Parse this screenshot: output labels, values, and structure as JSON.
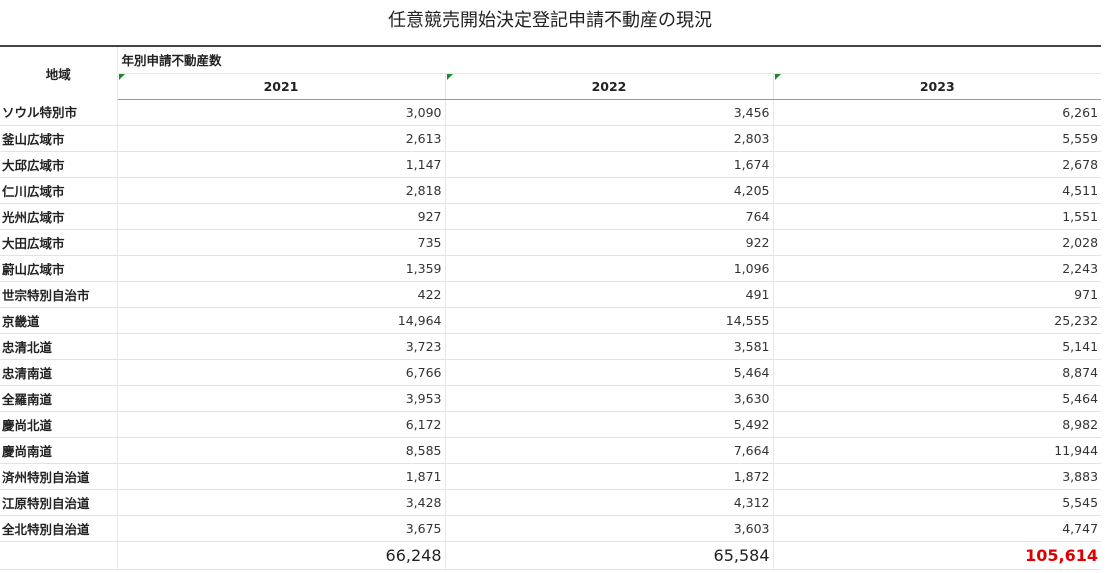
{
  "title": "任意競売開始決定登記申請不動産の現況",
  "header": {
    "region_label": "地域",
    "group_label": "年別申請不動産数"
  },
  "colors": {
    "max_total": "#e00000",
    "corner_mark": "#1a8a2a"
  },
  "chart_data": {
    "type": "table",
    "title": "任意競売開始決定登記申請不動産の現況",
    "row_header": "地域",
    "column_group": "年別申請不動産数",
    "columns": [
      "2021",
      "2022",
      "2023"
    ],
    "rows": [
      {
        "region": "ソウル特別市",
        "values": [
          "3,090",
          "3,456",
          "6,261"
        ]
      },
      {
        "region": "釜山広域市",
        "values": [
          "2,613",
          "2,803",
          "5,559"
        ]
      },
      {
        "region": "大邱広域市",
        "values": [
          "1,147",
          "1,674",
          "2,678"
        ]
      },
      {
        "region": "仁川広域市",
        "values": [
          "2,818",
          "4,205",
          "4,511"
        ]
      },
      {
        "region": "光州広域市",
        "values": [
          "927",
          "764",
          "1,551"
        ]
      },
      {
        "region": "大田広域市",
        "values": [
          "735",
          "922",
          "2,028"
        ]
      },
      {
        "region": "蔚山広域市",
        "values": [
          "1,359",
          "1,096",
          "2,243"
        ]
      },
      {
        "region": "世宗特別自治市",
        "values": [
          "422",
          "491",
          "971"
        ]
      },
      {
        "region": "京畿道",
        "values": [
          "14,964",
          "14,555",
          "25,232"
        ]
      },
      {
        "region": "忠清北道",
        "values": [
          "3,723",
          "3,581",
          "5,141"
        ]
      },
      {
        "region": "忠清南道",
        "values": [
          "6,766",
          "5,464",
          "8,874"
        ]
      },
      {
        "region": "全羅南道",
        "values": [
          "3,953",
          "3,630",
          "5,464"
        ]
      },
      {
        "region": "慶尚北道",
        "values": [
          "6,172",
          "5,492",
          "8,982"
        ]
      },
      {
        "region": "慶尚南道",
        "values": [
          "8,585",
          "7,664",
          "11,944"
        ]
      },
      {
        "region": "済州特別自治道",
        "values": [
          "1,871",
          "1,872",
          "3,883"
        ]
      },
      {
        "region": "江原特別自治道",
        "values": [
          "3,428",
          "4,312",
          "5,545"
        ]
      },
      {
        "region": "全北特別自治道",
        "values": [
          "3,675",
          "3,603",
          "4,747"
        ]
      }
    ],
    "totals": [
      "66,248",
      "65,584",
      "105,614"
    ],
    "highlight_total_index": 2
  }
}
